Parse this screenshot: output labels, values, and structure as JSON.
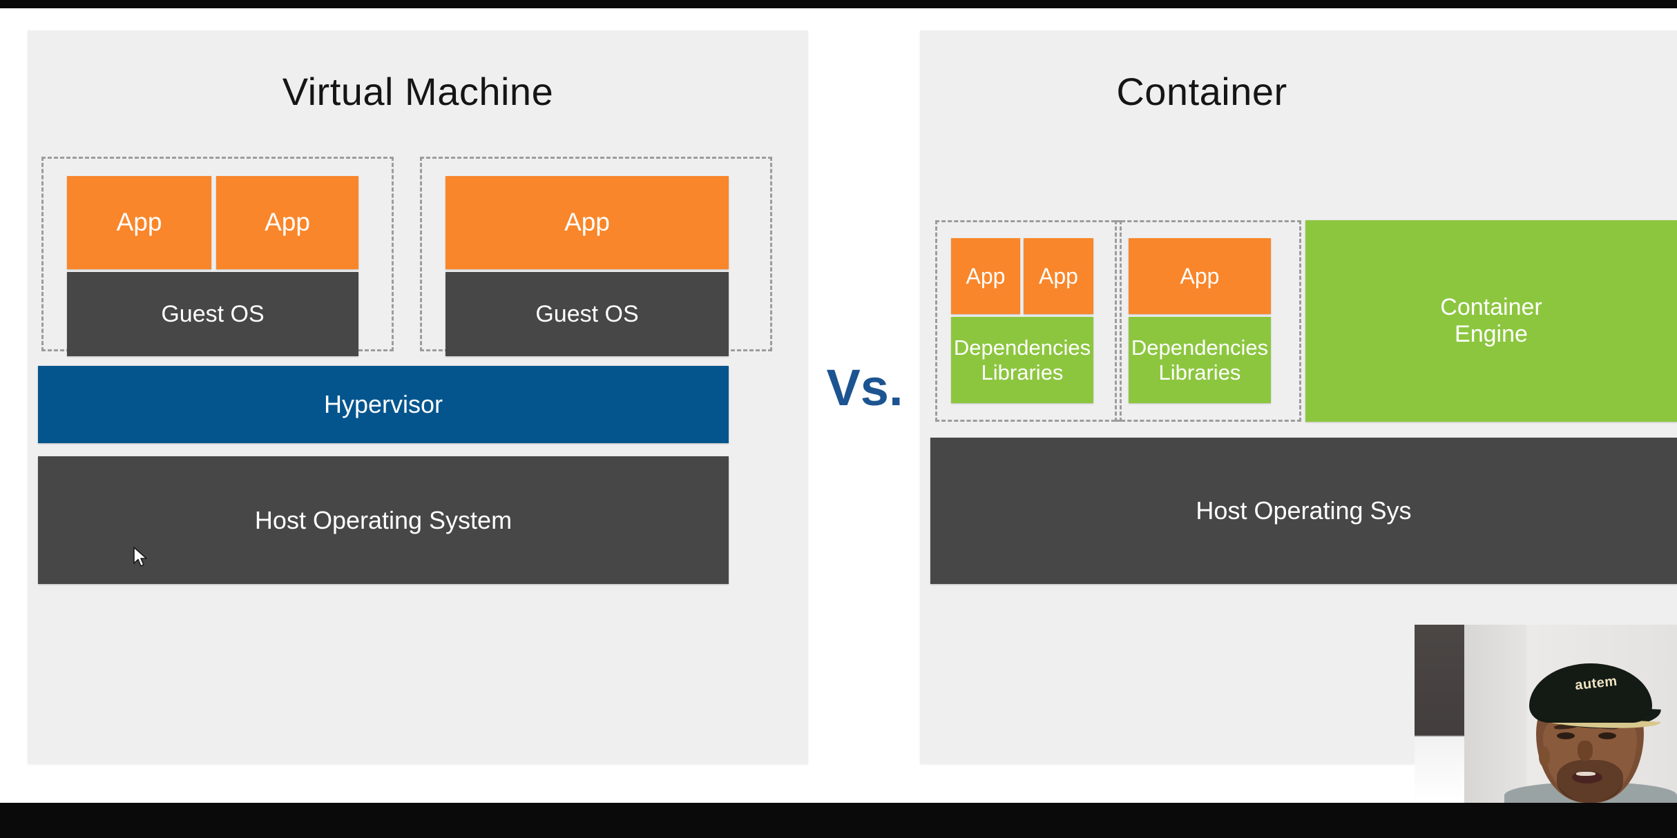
{
  "slide": {
    "vs_label": "Vs.",
    "left_panel": {
      "title": "Virtual Machine",
      "groups": [
        {
          "apps": [
            "App",
            "App"
          ],
          "guest_os": "Guest OS"
        },
        {
          "apps": [
            "App"
          ],
          "guest_os": "Guest OS"
        }
      ],
      "hypervisor": "Hypervisor",
      "host_os": "Host Operating System"
    },
    "right_panel": {
      "title": "Container",
      "groups": [
        {
          "apps": [
            "App",
            "App"
          ],
          "dependencies": "Dependencies\nLibraries"
        },
        {
          "apps": [
            "App"
          ],
          "dependencies": "Dependencies\nLibraries"
        }
      ],
      "container_engine": "Container\nEngine",
      "host_os": "Host Operating Sys"
    }
  },
  "webcam": {
    "cap_text": "autem"
  },
  "colors": {
    "app_orange": "#f9862a",
    "dependencies_green": "#8cc63f",
    "os_dark_gray": "#474747",
    "hypervisor_blue": "#04558d",
    "vs_blue": "#1c5491",
    "panel_background": "#efefef",
    "dashed_border": "#9c9c9c",
    "letterbox_black": "#0a0a0a"
  }
}
